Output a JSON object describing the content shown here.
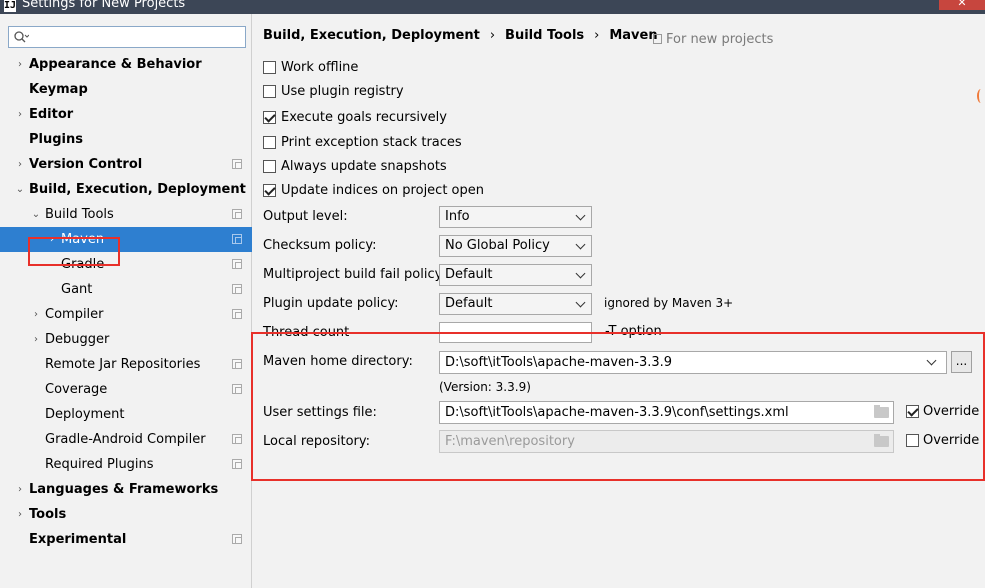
{
  "window": {
    "title": "Settings for New Projects",
    "close_glyph": "✕",
    "app_icon_glyph": "IJ"
  },
  "search": {
    "placeholder": ""
  },
  "tree": [
    {
      "label": "Appearance & Behavior",
      "indent": 0,
      "bold": true,
      "arrow": "›",
      "copy": false
    },
    {
      "label": "Keymap",
      "indent": 0,
      "bold": true,
      "arrow": "",
      "copy": false
    },
    {
      "label": "Editor",
      "indent": 0,
      "bold": true,
      "arrow": "›",
      "copy": false
    },
    {
      "label": "Plugins",
      "indent": 0,
      "bold": true,
      "arrow": "",
      "copy": false
    },
    {
      "label": "Version Control",
      "indent": 0,
      "bold": true,
      "arrow": "›",
      "copy": true
    },
    {
      "label": "Build, Execution, Deployment",
      "indent": 0,
      "bold": true,
      "arrow": "⌄",
      "copy": false
    },
    {
      "label": "Build Tools",
      "indent": 1,
      "bold": false,
      "arrow": "⌄",
      "copy": true
    },
    {
      "label": "Maven",
      "indent": 2,
      "bold": false,
      "arrow": "›",
      "copy": true,
      "selected": true
    },
    {
      "label": "Gradle",
      "indent": 2,
      "bold": false,
      "arrow": "",
      "copy": true
    },
    {
      "label": "Gant",
      "indent": 2,
      "bold": false,
      "arrow": "",
      "copy": true
    },
    {
      "label": "Compiler",
      "indent": 1,
      "bold": false,
      "arrow": "›",
      "copy": true
    },
    {
      "label": "Debugger",
      "indent": 1,
      "bold": false,
      "arrow": "›",
      "copy": false
    },
    {
      "label": "Remote Jar Repositories",
      "indent": 1,
      "bold": false,
      "arrow": "",
      "copy": true
    },
    {
      "label": "Coverage",
      "indent": 1,
      "bold": false,
      "arrow": "",
      "copy": true
    },
    {
      "label": "Deployment",
      "indent": 1,
      "bold": false,
      "arrow": "",
      "copy": false
    },
    {
      "label": "Gradle-Android Compiler",
      "indent": 1,
      "bold": false,
      "arrow": "",
      "copy": true
    },
    {
      "label": "Required Plugins",
      "indent": 1,
      "bold": false,
      "arrow": "",
      "copy": true
    },
    {
      "label": "Languages & Frameworks",
      "indent": 0,
      "bold": true,
      "arrow": "›",
      "copy": false
    },
    {
      "label": "Tools",
      "indent": 0,
      "bold": true,
      "arrow": "›",
      "copy": false
    },
    {
      "label": "Experimental",
      "indent": 0,
      "bold": true,
      "arrow": "",
      "copy": true
    }
  ],
  "breadcrumb": {
    "part1": "Build, Execution, Deployment",
    "part2": "Build Tools",
    "part3": "Maven",
    "separator": "›",
    "scope_note": "For new projects"
  },
  "checkboxes": [
    {
      "label": "Work offline",
      "checked": false
    },
    {
      "label": "Use plugin registry",
      "checked": false
    },
    {
      "label": "Execute goals recursively",
      "checked": true
    },
    {
      "label": "Print exception stack traces",
      "checked": false
    },
    {
      "label": "Always update snapshots",
      "checked": false
    },
    {
      "label": "Update indices on project open",
      "checked": true
    }
  ],
  "options": {
    "output_level": {
      "label": "Output level:",
      "value": "Info"
    },
    "checksum_policy": {
      "label": "Checksum policy:",
      "value": "No Global Policy"
    },
    "multiproject_policy": {
      "label": "Multiproject build fail policy:",
      "value": "Default"
    },
    "plugin_update_policy": {
      "label": "Plugin update policy:",
      "value": "Default",
      "note": "ignored by Maven 3+"
    },
    "thread_count": {
      "label": "Thread count",
      "value": "",
      "option_note": "-T option"
    }
  },
  "maven": {
    "home_label": "Maven home directory:",
    "home_value": "D:\\soft\\itTools\\apache-maven-3.3.9",
    "browse_label": "...",
    "version": "(Version: 3.3.9)",
    "settings_label": "User settings file:",
    "settings_value": "D:\\soft\\itTools\\apache-maven-3.3.9\\conf\\settings.xml",
    "settings_override": {
      "label": "Override",
      "checked": true
    },
    "repo_label": "Local repository:",
    "repo_value": "F:\\maven\\repository",
    "repo_override": {
      "label": "Override",
      "checked": false
    }
  },
  "colors": {
    "selection": "#2e7fd0",
    "highlight": "#e8302a"
  }
}
